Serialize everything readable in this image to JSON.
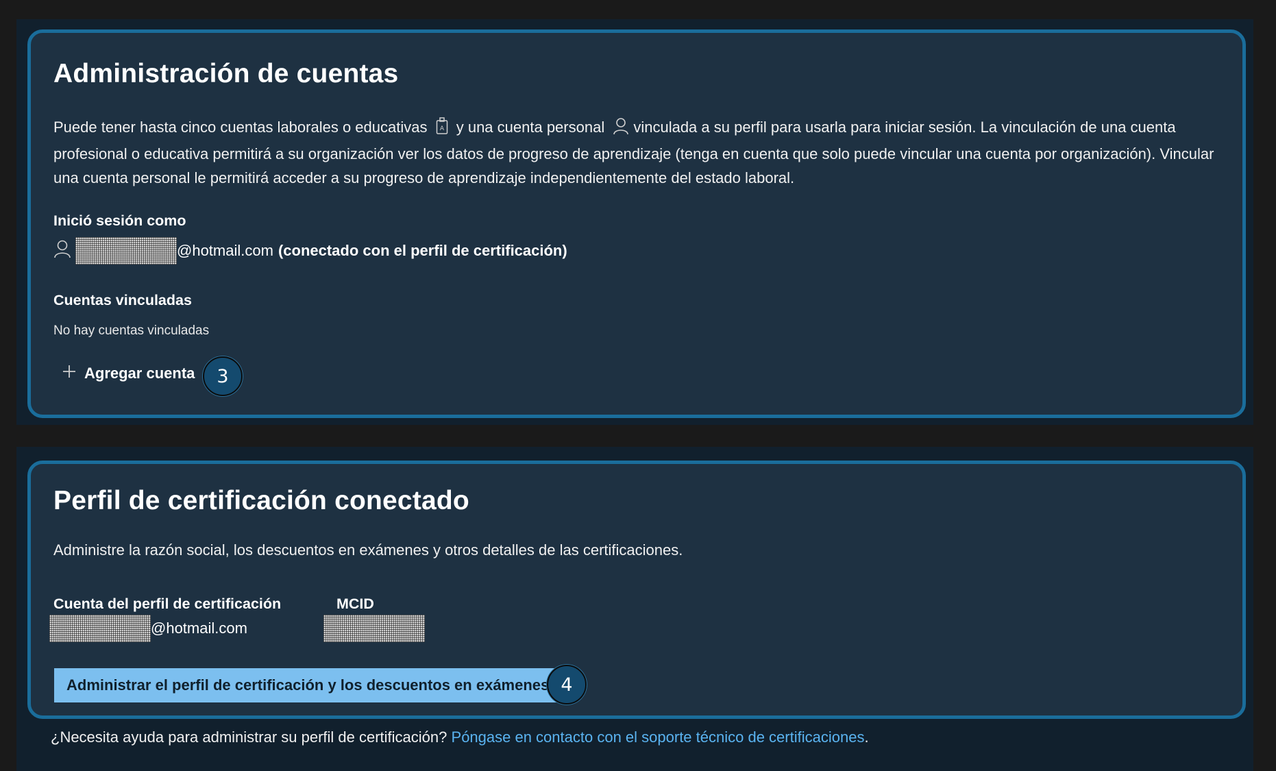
{
  "account_management": {
    "title": "Administración de cuentas",
    "description_part1": "Puede tener hasta cinco cuentas laborales o educativas",
    "description_part2": "y una cuenta personal",
    "description_part3": "vinculada a su perfil para usarla para iniciar sesión. La vinculación de una cuenta profesional o educativa permitirá a su organización ver los datos de progreso de aprendizaje (tenga en cuenta que solo puede vincular una cuenta por organización). Vincular una cuenta personal le permitirá acceder a su progreso de aprendizaje independientemente del estado laboral.",
    "signed_in_label": "Inició sesión como",
    "signed_in_email_domain": "@hotmail.com",
    "signed_in_note": "(conectado con el perfil de certificación)",
    "linked_accounts_label": "Cuentas vinculadas",
    "linked_accounts_empty": "No hay cuentas vinculadas",
    "add_account_label": "Agregar cuenta",
    "step_badge": "3"
  },
  "certification_profile": {
    "title": "Perfil de certificación conectado",
    "description": "Administre la razón social, los descuentos en exámenes y otros detalles de las certificaciones.",
    "account_label": "Cuenta del perfil de certificación",
    "account_email_domain": "@hotmail.com",
    "mcid_label": "MCID",
    "manage_button": "Administrar el perfil de certificación y los descuentos en exámenes",
    "step_badge": "4"
  },
  "help": {
    "question": "¿Necesita ayuda para administrar su perfil de certificación?",
    "link_text": "Póngase en contacto con el soporte técnico de certificaciones",
    "trailing": "."
  },
  "colors": {
    "page_bg": "#1a1a1a",
    "section_bg": "#11202d",
    "card_bg": "#1e3142",
    "card_border": "#1a6d9b",
    "badge_bg": "#144a6e",
    "primary_button_bg": "#7cbfef",
    "link": "#5ab3f0"
  }
}
